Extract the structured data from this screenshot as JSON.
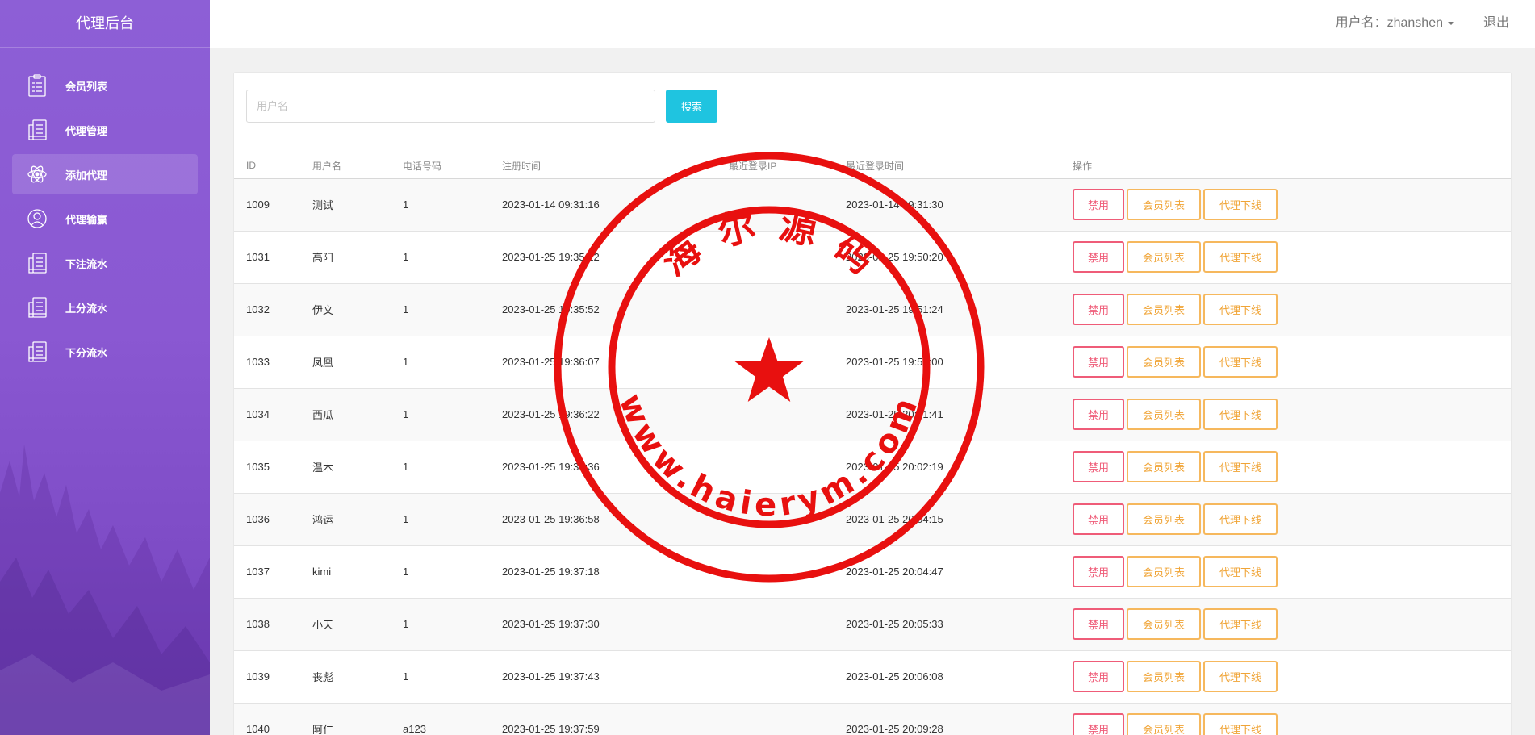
{
  "sidebar": {
    "title": "代理后台",
    "items": [
      {
        "label": "会员列表",
        "icon": "clipboard-icon",
        "active": false
      },
      {
        "label": "代理管理",
        "icon": "ledger-icon",
        "active": false
      },
      {
        "label": "添加代理",
        "icon": "atom-icon",
        "active": true
      },
      {
        "label": "代理输赢",
        "icon": "user-circle-icon",
        "active": false
      },
      {
        "label": "下注流水",
        "icon": "ledger-icon",
        "active": false
      },
      {
        "label": "上分流水",
        "icon": "ledger-icon",
        "active": false
      },
      {
        "label": "下分流水",
        "icon": "ledger-icon",
        "active": false
      }
    ]
  },
  "topbar": {
    "user_label": "用户名：zhanshen",
    "logout": "退出"
  },
  "search": {
    "placeholder": "用户名",
    "button": "搜索"
  },
  "table": {
    "headers": [
      "ID",
      "用户名",
      "电话号码",
      "注册时间",
      "最近登录IP",
      "最近登录时间",
      "操作"
    ],
    "actions": {
      "ban": "禁用",
      "members": "会员列表",
      "offline": "代理下线"
    },
    "rows": [
      [
        "1009",
        "测试",
        "1",
        "2023-01-14 09:31:16",
        "",
        "2023-01-14 09:31:30"
      ],
      [
        "1031",
        "高阳",
        "1",
        "2023-01-25 19:35:22",
        "",
        "2023-01-25 19:50:20"
      ],
      [
        "1032",
        "伊文",
        "1",
        "2023-01-25 19:35:52",
        "",
        "2023-01-25 19:51:24"
      ],
      [
        "1033",
        "凤凰",
        "1",
        "2023-01-25 19:36:07",
        "",
        "2023-01-25 19:52:00"
      ],
      [
        "1034",
        "西瓜",
        "1",
        "2023-01-25 19:36:22",
        "",
        "2023-01-25 20:01:41"
      ],
      [
        "1035",
        "温木",
        "1",
        "2023-01-25 19:36:36",
        "",
        "2023-01-25 20:02:19"
      ],
      [
        "1036",
        "鸿运",
        "1",
        "2023-01-25 19:36:58",
        "",
        "2023-01-25 20:04:15"
      ],
      [
        "1037",
        "kimi",
        "1",
        "2023-01-25 19:37:18",
        "",
        "2023-01-25 20:04:47"
      ],
      [
        "1038",
        "小天",
        "1",
        "2023-01-25 19:37:30",
        "",
        "2023-01-25 20:05:33"
      ],
      [
        "1039",
        "丧彪",
        "1",
        "2023-01-25 19:37:43",
        "",
        "2023-01-25 20:06:08"
      ],
      [
        "1040",
        "阿仁",
        "a123",
        "2023-01-25 19:37:59",
        "",
        "2023-01-25 20:09:28"
      ]
    ]
  },
  "stamp": {
    "top_text": "海 尔 源 码",
    "bottom_text": "www.haierym.com",
    "color": "#e8100f"
  }
}
